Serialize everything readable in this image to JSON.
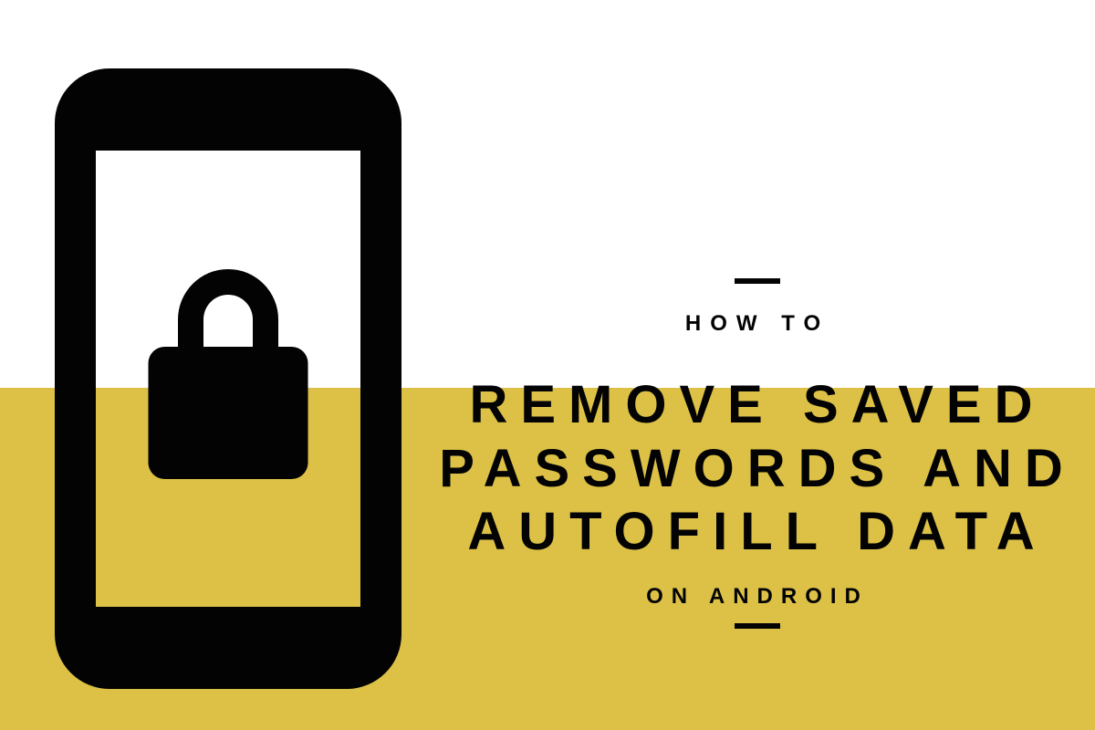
{
  "text": {
    "eyebrow": "HOW TO",
    "main_title": "REMOVE SAVED PASSWORDS AND AUTOFILL DATA",
    "subtitle": "ON ANDROID"
  },
  "colors": {
    "yellow": "#dcc146",
    "black": "#030304",
    "white": "#ffffff"
  }
}
